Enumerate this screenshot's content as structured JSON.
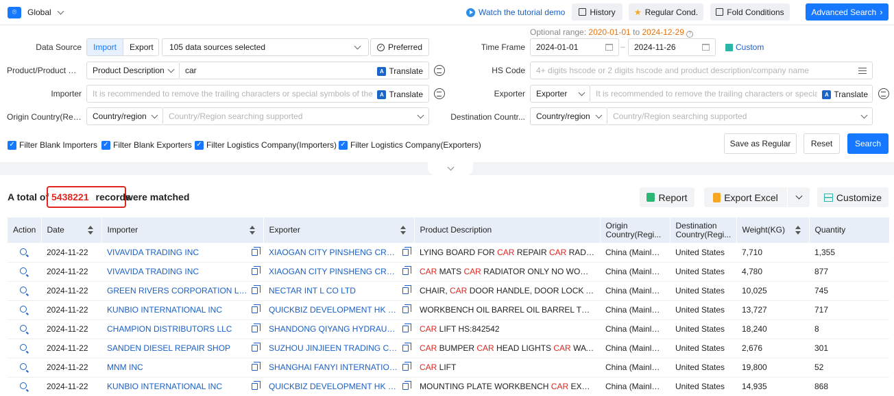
{
  "topbar": {
    "scope": "Global",
    "tutorial": "Watch the tutorial demo",
    "history": "History",
    "regular_cond": "Regular Cond.",
    "fold_conditions": "Fold Conditions",
    "advanced_search": "Advanced Search"
  },
  "optional_range": {
    "label": "Optional range:",
    "from": "2020-01-01",
    "to_word": "to",
    "to": "2024-12-29"
  },
  "filters": {
    "data_source": {
      "label": "Data Source",
      "import": "Import",
      "export": "Export",
      "selected": "105 data sources selected",
      "preferred": "Preferred"
    },
    "time_frame": {
      "label": "Time Frame",
      "start": "2024-01-01",
      "sep": "–",
      "end": "2024-11-26",
      "custom": "Custom"
    },
    "product": {
      "label": "Product/Product D...",
      "type": "Product Description",
      "value": "car",
      "translate": "Translate"
    },
    "hs_code": {
      "label": "HS Code",
      "placeholder": "4+ digits hscode or 2 digits hscode and product description/company name"
    },
    "importer": {
      "label": "Importer",
      "placeholder": "It is recommended to remove the trailing characters or special symbols of the com",
      "translate": "Translate"
    },
    "exporter": {
      "label": "Exporter",
      "type": "Exporter",
      "placeholder": "It is recommended to remove the trailing characters or special sy",
      "translate": "Translate"
    },
    "origin": {
      "label": "Origin Country(Regi...",
      "type": "Country/region",
      "placeholder": "Country/Region searching supported"
    },
    "destination": {
      "label": "Destination Countr...",
      "type": "Country/region",
      "placeholder": "Country/Region searching supported"
    }
  },
  "checkboxes": [
    "Filter Blank Importers",
    "Filter Blank Exporters",
    "Filter Logistics Company(Importers)",
    "Filter Logistics Company(Exporters)"
  ],
  "actions": {
    "save_regular": "Save as Regular",
    "reset": "Reset",
    "search": "Search"
  },
  "results": {
    "prefix": "A total of",
    "count": "5438221",
    "records": "records",
    "suffix": "were matched",
    "report": "Report",
    "export_excel": "Export Excel",
    "customize": "Customize"
  },
  "table": {
    "headers": [
      "Action",
      "Date",
      "Importer",
      "Exporter",
      "Product Description",
      "Origin Country(Regi...",
      "Destination Country(Regi...",
      "Weight(KG)",
      "Quantity"
    ],
    "rows": [
      {
        "date": "2024-11-22",
        "importer": "VIVAVIDA TRADING INC",
        "exporter": "XIAOGAN CITY PINSHENG CROSS ...",
        "product": "LYING BOARD FOR CAR REPAIR CAR RADIATOR ...",
        "origin": "China (Mainland)",
        "dest": "United States",
        "weight": "7,710",
        "qty": "1,355"
      },
      {
        "date": "2024-11-22",
        "importer": "VIVAVIDA TRADING INC",
        "exporter": "XIAOGAN CITY PINSHENG CROSS ...",
        "product": "CAR MATS CAR RADIATOR ONLY NO WOOD PAC...",
        "origin": "China (Mainland)",
        "dest": "United States",
        "weight": "4,780",
        "qty": "877"
      },
      {
        "date": "2024-11-22",
        "importer": "GREEN RIVERS CORPORATION LLC",
        "exporter": "NECTAR INT L CO LTD",
        "product": "CHAIR, CAR DOOR HANDLE, DOOR LOCK ACTUAT...",
        "origin": "China (Mainland)",
        "dest": "United States",
        "weight": "10,025",
        "qty": "745"
      },
      {
        "date": "2024-11-22",
        "importer": "KUNBIO INTERNATIONAL INC",
        "exporter": "QUICKBIZ DEVELOPMENT HK LIMI...",
        "product": "WORKBENCH OIL BARREL OIL BARREL TRANSLA...",
        "origin": "China (Mainland)",
        "dest": "United States",
        "weight": "13,727",
        "qty": "717"
      },
      {
        "date": "2024-11-22",
        "importer": "CHAMPION DISTRIBUTORS LLC",
        "exporter": "SHANDONG QIYANG HYDRAULIC ...",
        "product": "CAR LIFT HS:842542",
        "origin": "China (Mainland)",
        "dest": "United States",
        "weight": "18,240",
        "qty": "8"
      },
      {
        "date": "2024-11-22",
        "importer": "SANDEN DIESEL REPAIR SHOP",
        "exporter": "SUZHOU JINJIEEN TRADING CO L...",
        "product": "CAR BUMPER CAR HEAD LIGHTS CAR WATER TA...",
        "origin": "China (Mainland)",
        "dest": "United States",
        "weight": "2,676",
        "qty": "301"
      },
      {
        "date": "2024-11-22",
        "importer": "MNM INC",
        "exporter": "SHANGHAI FANYI INTERNATIONAL",
        "product": "CAR LIFT",
        "origin": "China (Mainland)",
        "dest": "United States",
        "weight": "19,800",
        "qty": "52"
      },
      {
        "date": "2024-11-22",
        "importer": "KUNBIO INTERNATIONAL INC",
        "exporter": "QUICKBIZ DEVELOPMENT HK LIMI...",
        "product": "MOUNTING PLATE WORKBENCH CAR EXHAUST ...",
        "origin": "China (Mainland)",
        "dest": "United States",
        "weight": "14,935",
        "qty": "868"
      }
    ]
  },
  "highlight_term": "CAR",
  "colors": {
    "accent": "#1677ff",
    "highlight": "#e0261f",
    "link": "#1a5fc6",
    "range_date": "#e8710a"
  }
}
